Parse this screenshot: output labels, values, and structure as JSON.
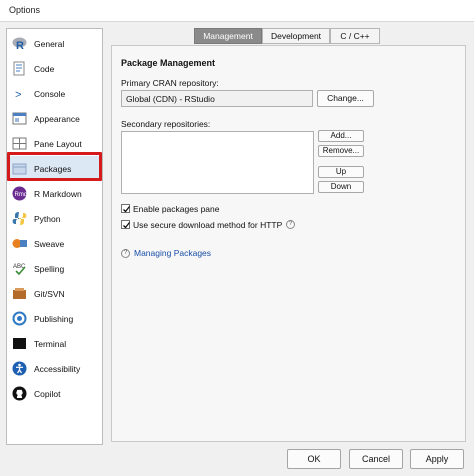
{
  "window": {
    "title": "Options"
  },
  "sidebar": {
    "items": [
      {
        "label": "General",
        "icon": "r-logo-icon"
      },
      {
        "label": "Code",
        "icon": "code-icon"
      },
      {
        "label": "Console",
        "icon": "console-icon"
      },
      {
        "label": "Appearance",
        "icon": "appearance-icon"
      },
      {
        "label": "Pane Layout",
        "icon": "pane-layout-icon"
      },
      {
        "label": "Packages",
        "icon": "packages-icon"
      },
      {
        "label": "R Markdown",
        "icon": "rmarkdown-icon"
      },
      {
        "label": "Python",
        "icon": "python-icon"
      },
      {
        "label": "Sweave",
        "icon": "sweave-icon"
      },
      {
        "label": "Spelling",
        "icon": "spelling-icon"
      },
      {
        "label": "Git/SVN",
        "icon": "git-icon"
      },
      {
        "label": "Publishing",
        "icon": "publishing-icon"
      },
      {
        "label": "Terminal",
        "icon": "terminal-icon"
      },
      {
        "label": "Accessibility",
        "icon": "accessibility-icon"
      },
      {
        "label": "Copilot",
        "icon": "github-icon"
      }
    ],
    "selected": "Packages",
    "highlight_color": "#d41a1a"
  },
  "tabs": [
    {
      "label": "Management",
      "active": true
    },
    {
      "label": "Development",
      "active": false
    },
    {
      "label": "C / C++",
      "active": false
    }
  ],
  "management": {
    "heading": "Package Management",
    "primary_label": "Primary CRAN repository:",
    "primary_value": "Global (CDN) - RStudio",
    "change_button": "Change...",
    "secondary_label": "Secondary repositories:",
    "add_button": "Add...",
    "remove_button": "Remove...",
    "up_button": "Up",
    "down_button": "Down",
    "enable_pane_label": "Enable packages pane",
    "enable_pane_checked": true,
    "secure_download_label": "Use secure download method for HTTP",
    "secure_download_checked": true,
    "help_link": "Managing Packages"
  },
  "footer": {
    "ok": "OK",
    "cancel": "Cancel",
    "apply": "Apply"
  }
}
